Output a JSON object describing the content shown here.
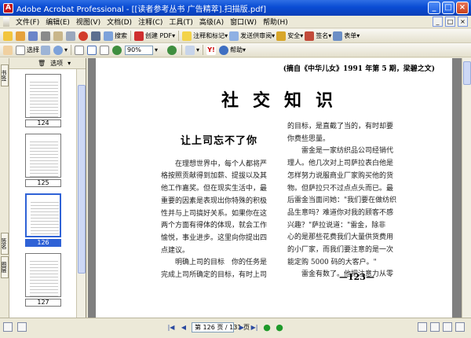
{
  "window": {
    "title": "Adobe Acrobat Professional - [[读者参考丛书 广告精萃].扫描版.pdf]",
    "app_glyph": "A",
    "minimize": "_",
    "maximize": "□",
    "close": "×"
  },
  "menu": [
    "文件(F)",
    "编辑(E)",
    "视图(V)",
    "文档(D)",
    "注释(C)",
    "工具(T)",
    "高级(A)",
    "窗口(W)",
    "帮助(H)"
  ],
  "doc_controls": {
    "minimize": "_",
    "restore": "□",
    "close": "×"
  },
  "toolbar1": {
    "create_pdf": "创建 PDF",
    "comment_markup": "注释和标记",
    "send_review": "发送供审阅",
    "secure": "安全",
    "sign": "签名",
    "forms": "表单",
    "search": "搜索"
  },
  "toolbar2": {
    "select": "选择",
    "zoom": "90%",
    "help": "帮助"
  },
  "left_tabs": {
    "bookmarks": "书签",
    "signatures": "签名",
    "layers": "图层"
  },
  "thumbs": {
    "options": "选项",
    "pages": [
      {
        "label": "124",
        "selected": false
      },
      {
        "label": "125",
        "selected": false
      },
      {
        "label": "126",
        "selected": true
      },
      {
        "label": "127",
        "selected": false
      }
    ]
  },
  "page": {
    "source": "(摘自《中华儿女》1991 年第 5 期，梁碧之文)",
    "heading": "社交知识",
    "article_title": "让上司忘不了你",
    "left_lines": [
      "　　在理想世界中，每个人都将严",
      "格按照贡献得到加薪、提拔以及其",
      "他工作嘉奖。但在现实生活中，最",
      "重要的因素是表现出你特殊的积极",
      "性并与上司搞好关系。如果你在这",
      "两个方面有得体的体现，就会工作",
      "愉悦，事业进步。这里向你提出四",
      "点建议。",
      "　　明确上司的目标　你的任务是",
      "完成上司所确定的目标，有时上司"
    ],
    "right_lines": [
      "的目标，是直截了当的，有时却要",
      "你费些思量。",
      "　　雷金是一家纺织品公司经销代",
      "理人。他几次对上司萨拉表白他是",
      "怎样努力说服商业厂家购买他的货",
      "物。但萨拉只不过点点头而已。最",
      "后雷金当面问她：\"我们要在做纺织",
      "品生意吗？难道你对我的顾客不感",
      "兴趣？\"萨拉说道：\"雷金，除非",
      "心的是那些花费我们大量供货费用",
      "的小厂家，而我们要注意的是一次",
      "能定购 5000 码的大客户。\"",
      "　　雷金有数了。他把注意力从零"
    ],
    "page_number": "—123—"
  },
  "status": {
    "page_indicator": "第 126 页 / 131 页"
  },
  "icons": {
    "first": "first-page-icon",
    "prev": "prev-page-icon",
    "next": "next-page-icon",
    "last": "last-page-icon",
    "back": "go-back-icon",
    "forward": "go-forward-icon"
  }
}
